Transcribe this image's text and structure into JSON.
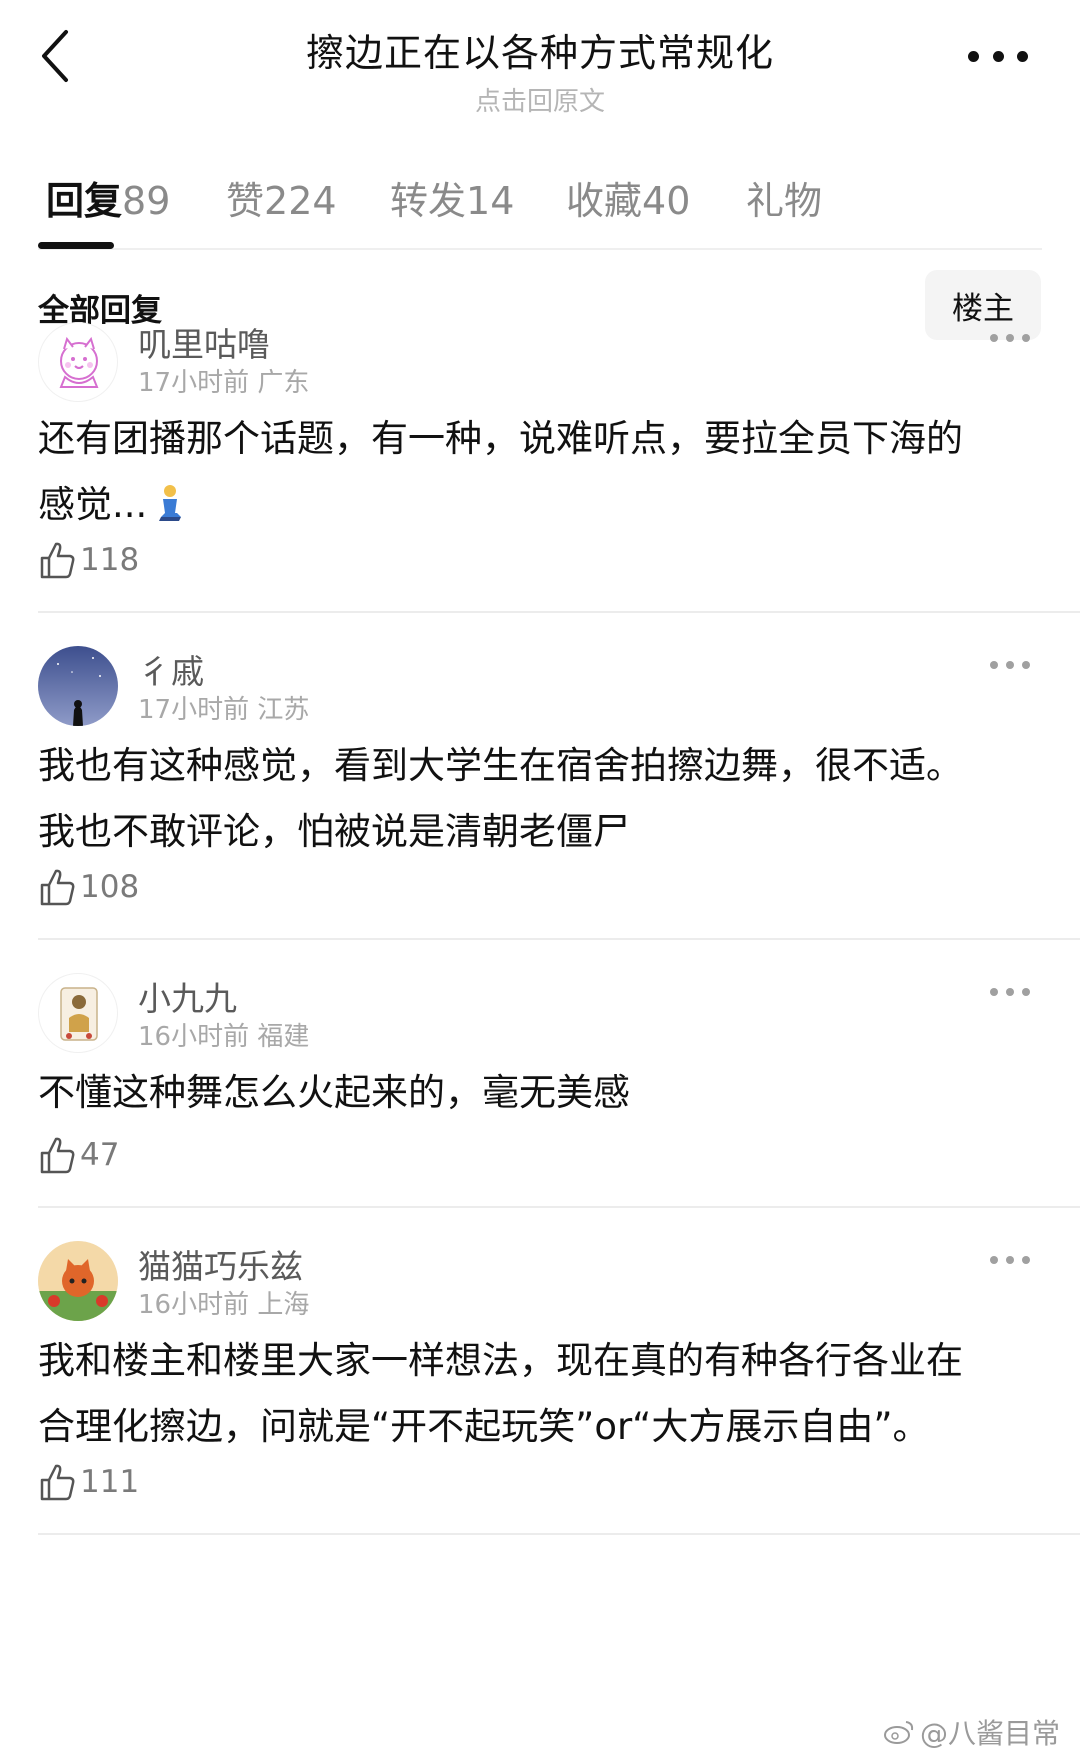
{
  "header": {
    "title": "擦边正在以各种方式常规化",
    "subtitle": "点击回原文"
  },
  "tabs": [
    {
      "name": "回复",
      "count": "89"
    },
    {
      "name": "赞",
      "count": "224"
    },
    {
      "name": "转发",
      "count": "14"
    },
    {
      "name": "收藏",
      "count": "40"
    },
    {
      "name": "礼物",
      "count": ""
    }
  ],
  "section": {
    "title": "全部回复",
    "owner_filter": "楼主"
  },
  "comments": [
    {
      "username": "叽里咕噜",
      "time": "17小时前",
      "location": "广东",
      "line1": "还有团播那个话题，有一种，说难听点，要拉全员下海的",
      "line2": "感觉...",
      "likes": "118"
    },
    {
      "username": "彳戚",
      "time": "17小时前",
      "location": "江苏",
      "line1": "我也有这种感觉，看到大学生在宿舍拍擦边舞，很不适。",
      "line2": "我也不敢评论，怕被说是清朝老僵尸",
      "likes": "108"
    },
    {
      "username": "小九九",
      "time": "16小时前",
      "location": "福建",
      "line1": "不懂这种舞怎么火起来的，毫无美感",
      "line2": "",
      "likes": "47"
    },
    {
      "username": "猫猫巧乐兹",
      "time": "16小时前",
      "location": "上海",
      "line1": "我和楼主和楼里大家一样想法，现在真的有种各行各业在",
      "line2": "合理化擦边，问就是“开不起玩笑”or“大方展示自由”。",
      "likes": "111"
    }
  ],
  "watermark": "@八酱目常"
}
